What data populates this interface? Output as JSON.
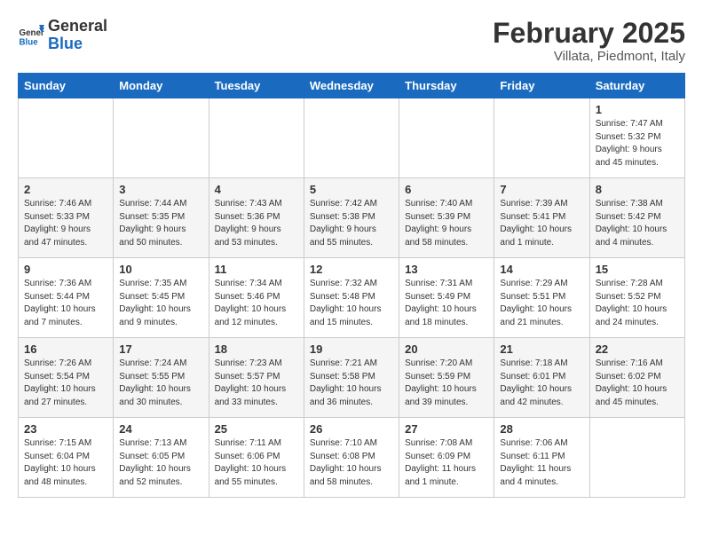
{
  "header": {
    "logo_general": "General",
    "logo_blue": "Blue",
    "month_title": "February 2025",
    "subtitle": "Villata, Piedmont, Italy"
  },
  "weekdays": [
    "Sunday",
    "Monday",
    "Tuesday",
    "Wednesday",
    "Thursday",
    "Friday",
    "Saturday"
  ],
  "weeks": [
    [
      {
        "day": "",
        "info": ""
      },
      {
        "day": "",
        "info": ""
      },
      {
        "day": "",
        "info": ""
      },
      {
        "day": "",
        "info": ""
      },
      {
        "day": "",
        "info": ""
      },
      {
        "day": "",
        "info": ""
      },
      {
        "day": "1",
        "info": "Sunrise: 7:47 AM\nSunset: 5:32 PM\nDaylight: 9 hours and 45 minutes."
      }
    ],
    [
      {
        "day": "2",
        "info": "Sunrise: 7:46 AM\nSunset: 5:33 PM\nDaylight: 9 hours and 47 minutes."
      },
      {
        "day": "3",
        "info": "Sunrise: 7:44 AM\nSunset: 5:35 PM\nDaylight: 9 hours and 50 minutes."
      },
      {
        "day": "4",
        "info": "Sunrise: 7:43 AM\nSunset: 5:36 PM\nDaylight: 9 hours and 53 minutes."
      },
      {
        "day": "5",
        "info": "Sunrise: 7:42 AM\nSunset: 5:38 PM\nDaylight: 9 hours and 55 minutes."
      },
      {
        "day": "6",
        "info": "Sunrise: 7:40 AM\nSunset: 5:39 PM\nDaylight: 9 hours and 58 minutes."
      },
      {
        "day": "7",
        "info": "Sunrise: 7:39 AM\nSunset: 5:41 PM\nDaylight: 10 hours and 1 minute."
      },
      {
        "day": "8",
        "info": "Sunrise: 7:38 AM\nSunset: 5:42 PM\nDaylight: 10 hours and 4 minutes."
      }
    ],
    [
      {
        "day": "9",
        "info": "Sunrise: 7:36 AM\nSunset: 5:44 PM\nDaylight: 10 hours and 7 minutes."
      },
      {
        "day": "10",
        "info": "Sunrise: 7:35 AM\nSunset: 5:45 PM\nDaylight: 10 hours and 9 minutes."
      },
      {
        "day": "11",
        "info": "Sunrise: 7:34 AM\nSunset: 5:46 PM\nDaylight: 10 hours and 12 minutes."
      },
      {
        "day": "12",
        "info": "Sunrise: 7:32 AM\nSunset: 5:48 PM\nDaylight: 10 hours and 15 minutes."
      },
      {
        "day": "13",
        "info": "Sunrise: 7:31 AM\nSunset: 5:49 PM\nDaylight: 10 hours and 18 minutes."
      },
      {
        "day": "14",
        "info": "Sunrise: 7:29 AM\nSunset: 5:51 PM\nDaylight: 10 hours and 21 minutes."
      },
      {
        "day": "15",
        "info": "Sunrise: 7:28 AM\nSunset: 5:52 PM\nDaylight: 10 hours and 24 minutes."
      }
    ],
    [
      {
        "day": "16",
        "info": "Sunrise: 7:26 AM\nSunset: 5:54 PM\nDaylight: 10 hours and 27 minutes."
      },
      {
        "day": "17",
        "info": "Sunrise: 7:24 AM\nSunset: 5:55 PM\nDaylight: 10 hours and 30 minutes."
      },
      {
        "day": "18",
        "info": "Sunrise: 7:23 AM\nSunset: 5:57 PM\nDaylight: 10 hours and 33 minutes."
      },
      {
        "day": "19",
        "info": "Sunrise: 7:21 AM\nSunset: 5:58 PM\nDaylight: 10 hours and 36 minutes."
      },
      {
        "day": "20",
        "info": "Sunrise: 7:20 AM\nSunset: 5:59 PM\nDaylight: 10 hours and 39 minutes."
      },
      {
        "day": "21",
        "info": "Sunrise: 7:18 AM\nSunset: 6:01 PM\nDaylight: 10 hours and 42 minutes."
      },
      {
        "day": "22",
        "info": "Sunrise: 7:16 AM\nSunset: 6:02 PM\nDaylight: 10 hours and 45 minutes."
      }
    ],
    [
      {
        "day": "23",
        "info": "Sunrise: 7:15 AM\nSunset: 6:04 PM\nDaylight: 10 hours and 48 minutes."
      },
      {
        "day": "24",
        "info": "Sunrise: 7:13 AM\nSunset: 6:05 PM\nDaylight: 10 hours and 52 minutes."
      },
      {
        "day": "25",
        "info": "Sunrise: 7:11 AM\nSunset: 6:06 PM\nDaylight: 10 hours and 55 minutes."
      },
      {
        "day": "26",
        "info": "Sunrise: 7:10 AM\nSunset: 6:08 PM\nDaylight: 10 hours and 58 minutes."
      },
      {
        "day": "27",
        "info": "Sunrise: 7:08 AM\nSunset: 6:09 PM\nDaylight: 11 hours and 1 minute."
      },
      {
        "day": "28",
        "info": "Sunrise: 7:06 AM\nSunset: 6:11 PM\nDaylight: 11 hours and 4 minutes."
      },
      {
        "day": "",
        "info": ""
      }
    ]
  ]
}
